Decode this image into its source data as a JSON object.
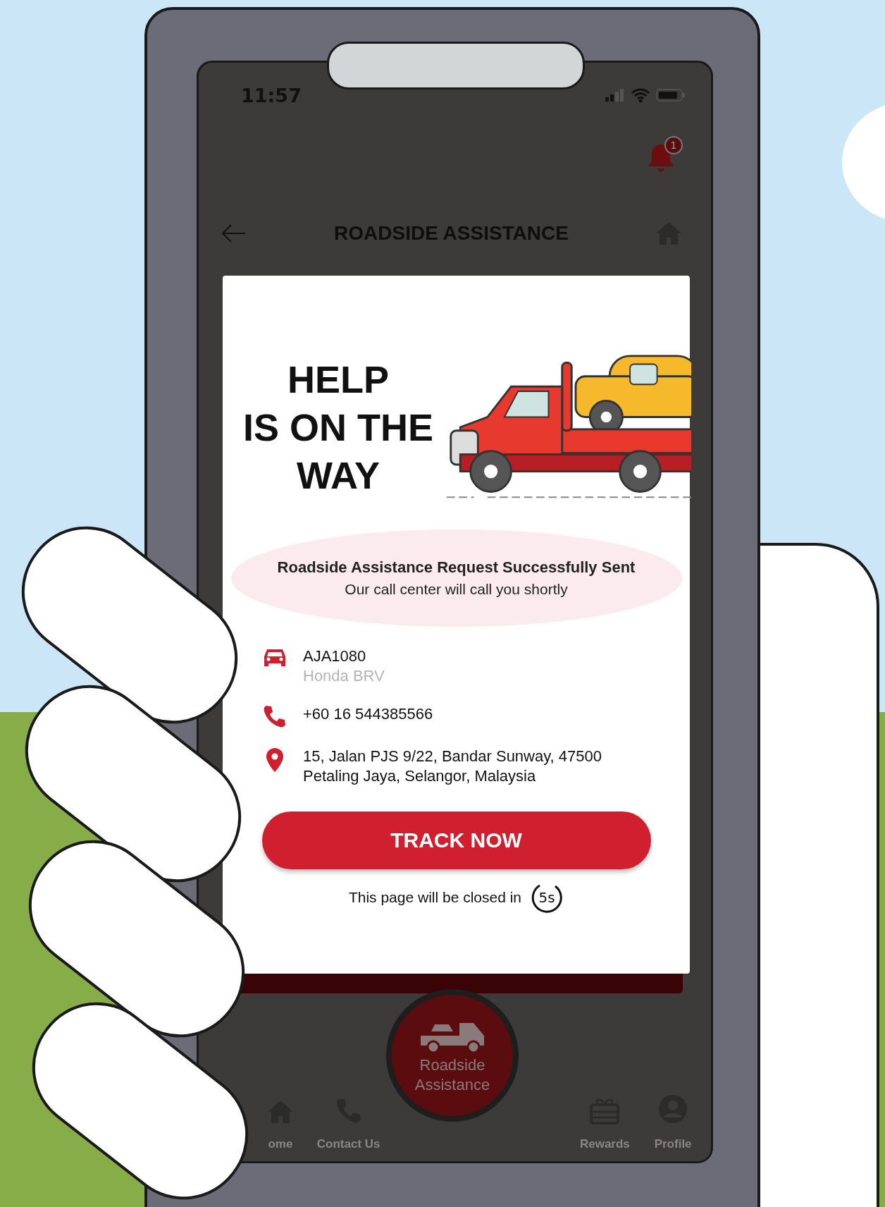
{
  "status_bar": {
    "time": "11:57"
  },
  "notification": {
    "badge": "1"
  },
  "header": {
    "title": "ROADSIDE ASSISTANCE"
  },
  "card": {
    "headline_lines": [
      "HELP",
      "IS ON THE",
      "WAY"
    ],
    "message": {
      "title": "Roadside Assistance Request Successfully Sent",
      "subtitle": "Our call center will call you shortly"
    },
    "details": [
      {
        "kind": "vehicle",
        "lines": [
          "AJA1080",
          "Honda BRV"
        ]
      },
      {
        "kind": "phone",
        "lines": [
          "+60 16 544385566"
        ]
      },
      {
        "kind": "location",
        "lines": [
          "15, Jalan PJS 9/22, Bandar Sunway, 47500",
          "Petaling Jaya, Selangor, Malaysia"
        ]
      }
    ],
    "button": "TRACK NOW",
    "closing_text": "This page will be closed in",
    "countdown": "5s"
  },
  "bottom_nav": [
    {
      "kind": "home",
      "label": "ome"
    },
    {
      "kind": "contact",
      "label": "Contact Us"
    },
    {
      "kind": "roadside",
      "label_lines": [
        "Roadside",
        "Assistance"
      ]
    },
    {
      "kind": "rewards",
      "label": "Rewards"
    },
    {
      "kind": "profile",
      "label": "Profile"
    }
  ]
}
